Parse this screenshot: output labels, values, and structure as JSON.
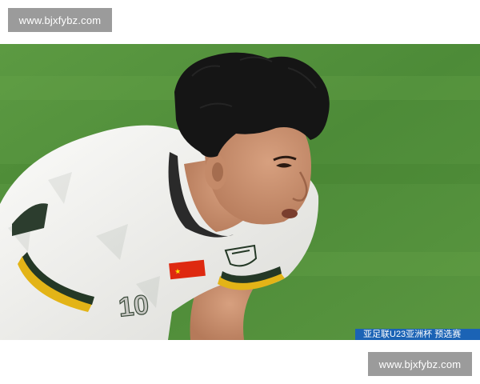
{
  "watermark": {
    "top_text": "www.bjxfybz.com",
    "bottom_text": "www.bjxfybz.com"
  },
  "photo": {
    "jersey_number": "10",
    "caption_text": "亚足联U23亚洲杯 预选赛"
  },
  "colors": {
    "pitch": "#4f8f3a",
    "jersey": "#f2f2f0",
    "trim_yellow": "#e3b417",
    "trim_dark": "#243826",
    "flag_red": "#de2910",
    "caption_bar": "#1b63b5",
    "watermark_bg": "#9b9b9b"
  }
}
